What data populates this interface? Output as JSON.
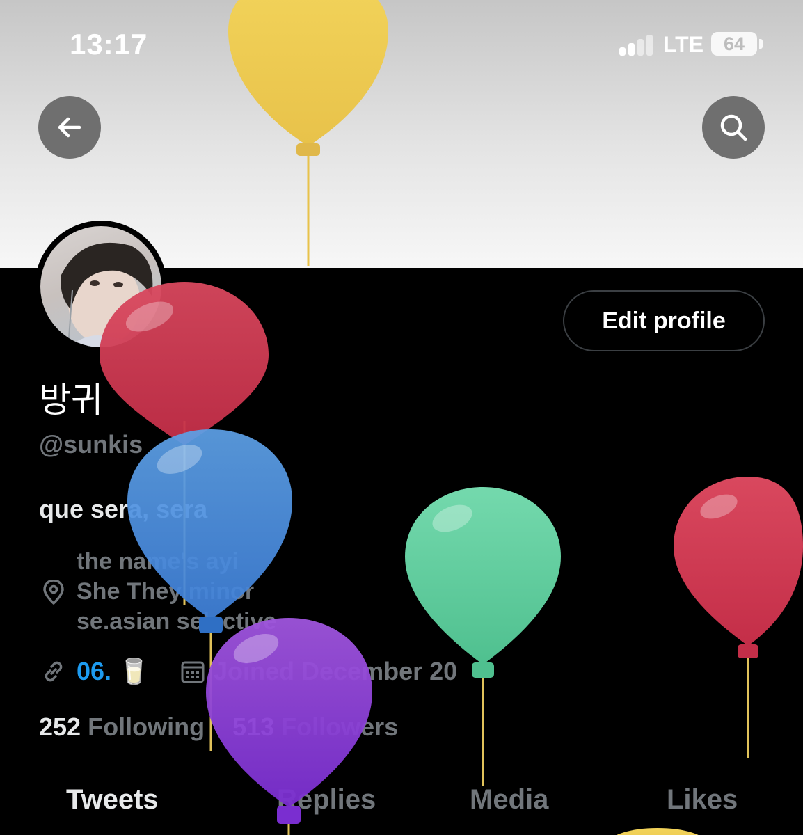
{
  "status_bar": {
    "time": "13:17",
    "network": "LTE",
    "battery": "64"
  },
  "profile": {
    "display_name": "방귀",
    "handle": "@sunkis",
    "bio": "que sera, sera",
    "location_lines": [
      "the name's ayi",
      "She They minor",
      "se.asian selective"
    ],
    "link": "06. 🥛",
    "joined": "Joined December 20",
    "edit_button": "Edit profile",
    "following_count": "252",
    "following_label": "Following",
    "followers_count": "513",
    "followers_label": "Followers"
  },
  "tabs": [
    "Tweets",
    "Replies",
    "Media",
    "Likes"
  ],
  "colors": {
    "accent": "#1d9bf0",
    "muted": "#71767b",
    "text": "#e7e9ea",
    "background": "#000000"
  },
  "icons": [
    "back-arrow-icon",
    "search-icon",
    "location-pin-icon",
    "link-icon",
    "calendar-icon",
    "signal-icon",
    "battery-icon"
  ]
}
